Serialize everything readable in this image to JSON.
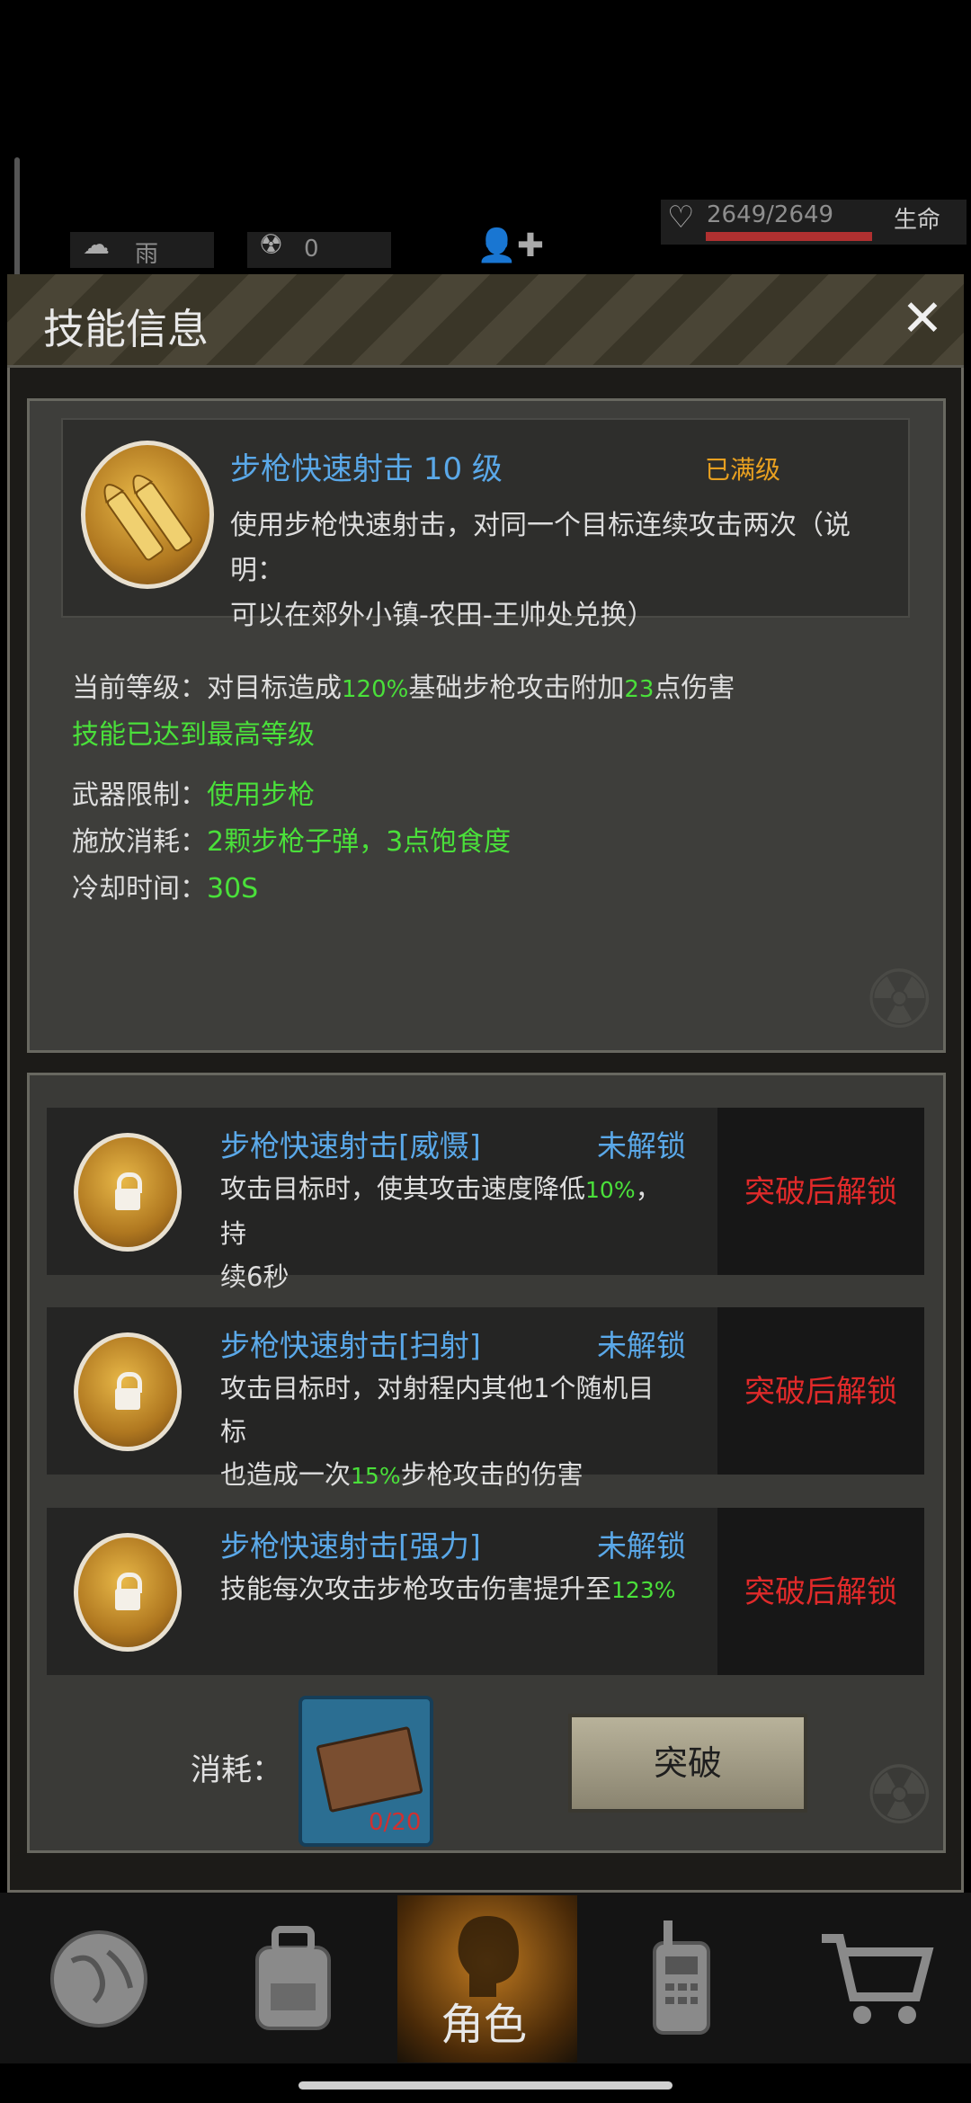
{
  "status": {
    "weather": "雨",
    "radiation": "0",
    "hp": "2649/2649",
    "hp_label": "生命",
    "hp_fraction": 1.0
  },
  "modal": {
    "title": "技能信息",
    "close_icon": "close-icon"
  },
  "skill": {
    "name": "步枪快速射击 10 级",
    "max_label": "已满级",
    "desc_line1": "使用步枪快速射击，对同一个目标连续攻击两次（说明：",
    "desc_line2": "可以在郊外小镇-农田-王帅处兑换）",
    "current_prefix": "当前等级：对目标造成",
    "current_pct": "120%",
    "current_mid": "基础步枪攻击附加",
    "current_dmg": "23",
    "current_suffix": "点伤害",
    "max_note": "技能已达到最高等级",
    "weapon_label": "武器限制：",
    "weapon_value": "使用步枪",
    "cost_label": "施放消耗：",
    "cost_value": "2颗步枪子弹，3点饱食度",
    "cooldown_label": "冷却时间：",
    "cooldown_value": "30S"
  },
  "sub_skills": [
    {
      "name": "步枪快速射击[威慑]",
      "status": "未解锁",
      "desc_a": "攻击目标时，使其攻击速度降低",
      "desc_pct": "10%",
      "desc_b": "，持",
      "desc_c": "续6秒",
      "lock_text": "突破后解锁"
    },
    {
      "name": "步枪快速射击[扫射]",
      "status": "未解锁",
      "desc_a": "攻击目标时，对射程内其他1个随机目标",
      "desc_c1": "也造成一次",
      "desc_pct": "15%",
      "desc_c2": "步枪攻击的伤害",
      "lock_text": "突破后解锁"
    },
    {
      "name": "步枪快速射击[强力]",
      "status": "未解锁",
      "desc_a": "技能每次攻击步枪攻击伤害提升至",
      "desc_pct": "123%",
      "lock_text": "突破后解锁"
    }
  ],
  "breakthrough": {
    "consume_label": "消耗：",
    "item_count": "0/20",
    "button_label": "突破"
  },
  "nav": {
    "items": [
      "globe-icon",
      "backpack-icon",
      "character-icon",
      "radio-icon",
      "cart-icon"
    ],
    "active_label": "角色"
  },
  "colors": {
    "accent_blue": "#5aa8e8",
    "highlight_green": "#4ae03a",
    "locked_red": "#e02a2a",
    "maxed_orange": "#e8a020"
  }
}
